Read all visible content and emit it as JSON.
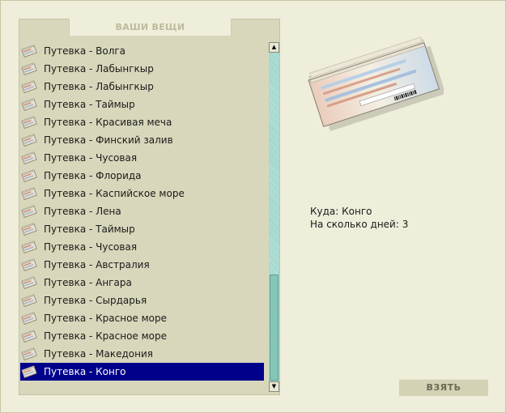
{
  "panel": {
    "title": "ВАШИ ВЕЩИ"
  },
  "items": [
    {
      "label": "Путевка - Волга",
      "icon": "ticket-icon"
    },
    {
      "label": "Путевка - Лабынгкыр",
      "icon": "ticket-icon"
    },
    {
      "label": "Путевка - Лабынгкыр",
      "icon": "ticket-icon"
    },
    {
      "label": "Путевка - Таймыр",
      "icon": "ticket-icon"
    },
    {
      "label": "Путевка - Красивая меча",
      "icon": "ticket-icon"
    },
    {
      "label": "Путевка - Финский залив",
      "icon": "ticket-icon"
    },
    {
      "label": "Путевка - Чусовая",
      "icon": "ticket-icon"
    },
    {
      "label": "Путевка - Флорида",
      "icon": "ticket-icon"
    },
    {
      "label": "Путевка - Каспийское море",
      "icon": "ticket-icon"
    },
    {
      "label": "Путевка - Лена",
      "icon": "ticket-icon"
    },
    {
      "label": "Путевка - Таймыр",
      "icon": "ticket-icon"
    },
    {
      "label": "Путевка - Чусовая",
      "icon": "ticket-icon"
    },
    {
      "label": "Путевка - Австралия",
      "icon": "ticket-icon"
    },
    {
      "label": "Путевка - Ангара",
      "icon": "ticket-icon"
    },
    {
      "label": "Путевка - Сырдарья",
      "icon": "ticket-icon"
    },
    {
      "label": "Путевка - Красное море",
      "icon": "ticket-icon"
    },
    {
      "label": "Путевка - Красное море",
      "icon": "ticket-icon"
    },
    {
      "label": "Путевка - Македония",
      "icon": "ticket-icon"
    },
    {
      "label": "Путевка - Конго",
      "icon": "ticket-icon",
      "selected": true
    }
  ],
  "details": {
    "destination": "Куда: Конго",
    "days": "На сколько дней: 3"
  },
  "take_button": {
    "label": "ВЗЯТЬ"
  },
  "colors": {
    "background": "#efeedb",
    "panel": "#d8d7bb",
    "selection": "#00008b",
    "scrollbar": "#84c6b8"
  }
}
